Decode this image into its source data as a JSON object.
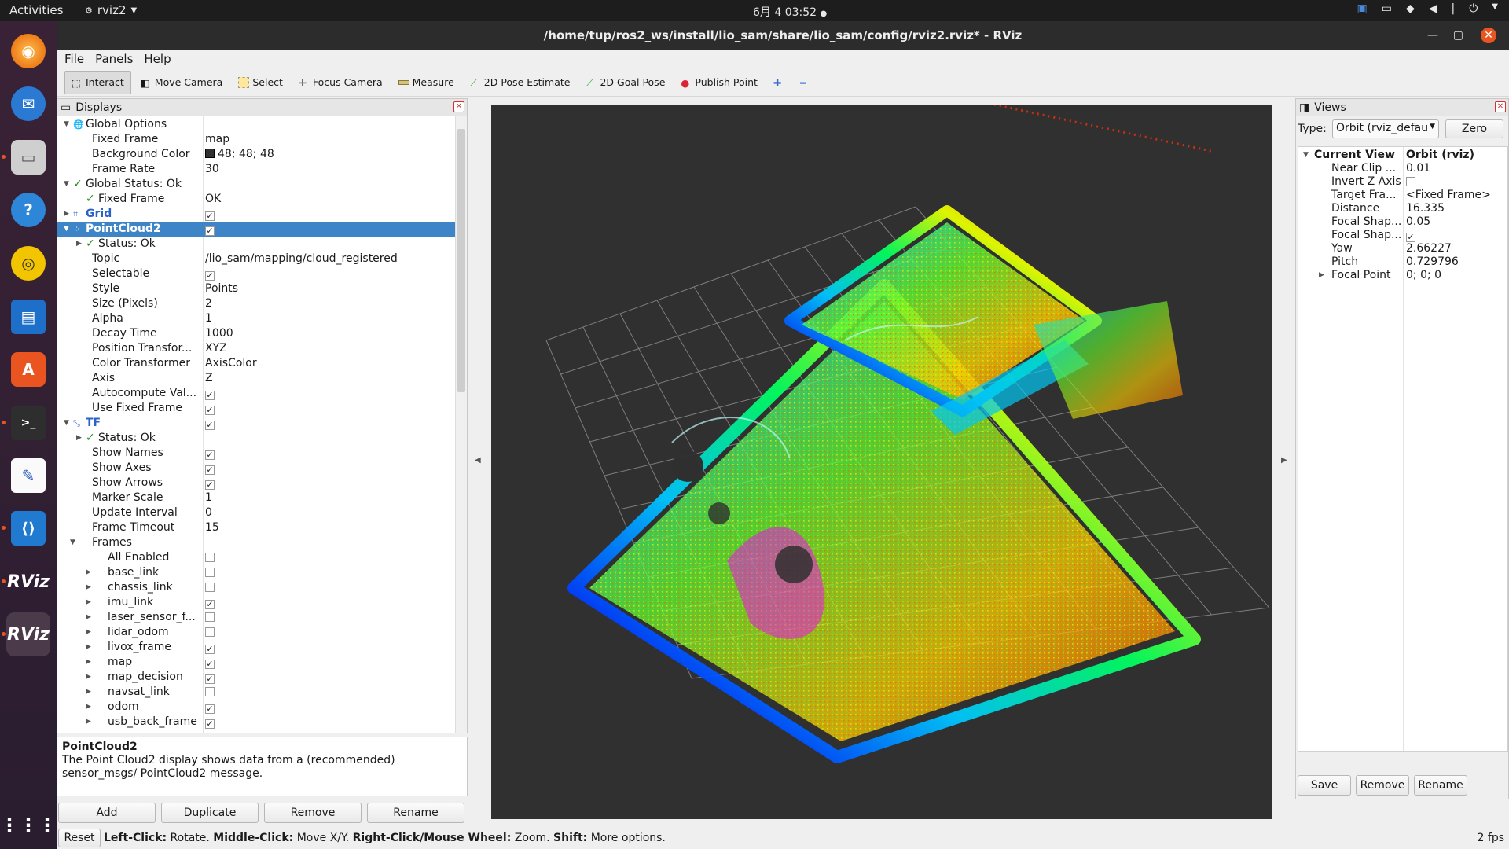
{
  "topbar": {
    "activities": "Activities",
    "app_name": "rviz2",
    "clock": "6月 4  03:52"
  },
  "window": {
    "title": "/home/tup/ros2_ws/install/lio_sam/share/lio_sam/config/rviz2.rviz* - RViz"
  },
  "menu": [
    "File",
    "Panels",
    "Help"
  ],
  "toolbar": {
    "interact": "Interact",
    "move_camera": "Move Camera",
    "select": "Select",
    "focus_camera": "Focus Camera",
    "measure": "Measure",
    "pose_estimate": "2D Pose Estimate",
    "goal_pose": "2D Goal Pose",
    "publish_point": "Publish Point"
  },
  "displays": {
    "title": "Displays",
    "rows": [
      {
        "label": "Global Options",
        "value": ""
      },
      {
        "label": "Fixed Frame",
        "value": "map"
      },
      {
        "label": "Background Color",
        "value": "48; 48; 48"
      },
      {
        "label": "Frame Rate",
        "value": "30"
      },
      {
        "label": "Global Status: Ok",
        "value": ""
      },
      {
        "label": "Fixed Frame",
        "value": "OK"
      },
      {
        "label": "Grid",
        "value": ""
      },
      {
        "label": "PointCloud2",
        "value": ""
      },
      {
        "label": "Status: Ok",
        "value": ""
      },
      {
        "label": "Topic",
        "value": "/lio_sam/mapping/cloud_registered"
      },
      {
        "label": "Selectable",
        "value": ""
      },
      {
        "label": "Style",
        "value": "Points"
      },
      {
        "label": "Size (Pixels)",
        "value": "2"
      },
      {
        "label": "Alpha",
        "value": "1"
      },
      {
        "label": "Decay Time",
        "value": "1000"
      },
      {
        "label": "Position Transfor...",
        "value": "XYZ"
      },
      {
        "label": "Color Transformer",
        "value": "AxisColor"
      },
      {
        "label": "Axis",
        "value": "Z"
      },
      {
        "label": "Autocompute Val...",
        "value": ""
      },
      {
        "label": "Use Fixed Frame",
        "value": ""
      },
      {
        "label": "TF",
        "value": ""
      },
      {
        "label": "Status: Ok",
        "value": ""
      },
      {
        "label": "Show Names",
        "value": ""
      },
      {
        "label": "Show Axes",
        "value": ""
      },
      {
        "label": "Show Arrows",
        "value": ""
      },
      {
        "label": "Marker Scale",
        "value": "1"
      },
      {
        "label": "Update Interval",
        "value": "0"
      },
      {
        "label": "Frame Timeout",
        "value": "15"
      },
      {
        "label": "Frames",
        "value": ""
      },
      {
        "label": "All Enabled",
        "value": ""
      },
      {
        "label": "base_link",
        "value": ""
      },
      {
        "label": "chassis_link",
        "value": ""
      },
      {
        "label": "imu_link",
        "value": ""
      },
      {
        "label": "laser_sensor_f...",
        "value": ""
      },
      {
        "label": "lidar_odom",
        "value": ""
      },
      {
        "label": "livox_frame",
        "value": ""
      },
      {
        "label": "map",
        "value": ""
      },
      {
        "label": "map_decision",
        "value": ""
      },
      {
        "label": "navsat_link",
        "value": ""
      },
      {
        "label": "odom",
        "value": ""
      },
      {
        "label": "usb_back_frame",
        "value": ""
      }
    ],
    "description_title": "PointCloud2",
    "description": "The Point Cloud2 display shows data from a (recommended) sensor_msgs/ PointCloud2 message.",
    "buttons": {
      "add": "Add",
      "duplicate": "Duplicate",
      "remove": "Remove",
      "rename": "Rename"
    }
  },
  "views": {
    "title": "Views",
    "type_label": "Type:",
    "type_value": "Orbit (rviz_defau",
    "zero": "Zero",
    "header_key": "Current View",
    "header_value": "Orbit (rviz)",
    "rows": [
      {
        "label": "Near Clip ...",
        "value": "0.01"
      },
      {
        "label": "Invert Z Axis",
        "value": ""
      },
      {
        "label": "Target Fra...",
        "value": "<Fixed Frame>"
      },
      {
        "label": "Distance",
        "value": "16.335"
      },
      {
        "label": "Focal Shap...",
        "value": "0.05"
      },
      {
        "label": "Focal Shap...",
        "value": ""
      },
      {
        "label": "Yaw",
        "value": "2.66227"
      },
      {
        "label": "Pitch",
        "value": "0.729796"
      },
      {
        "label": "Focal Point",
        "value": "0; 0; 0"
      }
    ],
    "buttons": {
      "save": "Save",
      "remove": "Remove",
      "rename": "Rename"
    }
  },
  "status": {
    "reset": "Reset",
    "help_b1": "Left-Click:",
    "help_t1": " Rotate. ",
    "help_b2": "Middle-Click:",
    "help_t2": " Move X/Y. ",
    "help_b3": "Right-Click/Mouse Wheel:",
    "help_t3": " Zoom. ",
    "help_b4": "Shift:",
    "help_t4": " More options.",
    "fps": "2 fps"
  },
  "colors": {
    "background": "#303030",
    "selection": "#3d85c6",
    "ok_green": "#1b8a1b",
    "dock_accent": "#e95420"
  }
}
